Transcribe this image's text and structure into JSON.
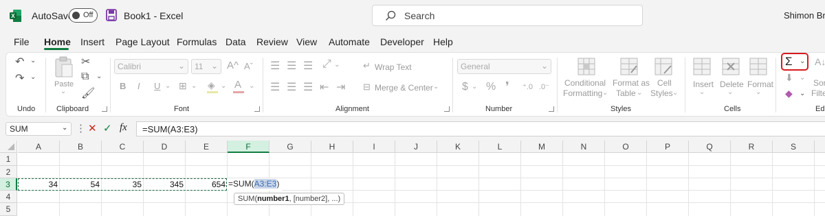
{
  "titlebar": {
    "autosave_label": "AutoSave",
    "autosave_state": "Off",
    "document_title": "Book1  -  Excel",
    "search_placeholder": "Search",
    "user_name": "Shimon Bra"
  },
  "menu": {
    "tabs": [
      "File",
      "Home",
      "Insert",
      "Page Layout",
      "Formulas",
      "Data",
      "Review",
      "View",
      "Automate",
      "Developer",
      "Help"
    ],
    "active": "Home"
  },
  "ribbon": {
    "groups": {
      "undo": "Undo",
      "clipboard": "Clipboard",
      "font": "Font",
      "alignment": "Alignment",
      "number": "Number",
      "styles": "Styles",
      "cells": "Cells",
      "editing": "Edi"
    },
    "clipboard": {
      "paste": "Paste"
    },
    "font": {
      "name": "Calibri",
      "size": "11",
      "bold": "B",
      "italic": "I",
      "underline": "U"
    },
    "alignment": {
      "wrap_text": "Wrap Text",
      "merge_center": "Merge & Center"
    },
    "number": {
      "format": "General",
      "currency": "$",
      "percent": "%"
    },
    "styles": {
      "conditional_formatting": [
        "Conditional",
        "Formatting"
      ],
      "format_as_table": [
        "Format as",
        "Table"
      ],
      "cell_styles": [
        "Cell",
        "Styles"
      ]
    },
    "cells": {
      "insert": "Insert",
      "delete": "Delete",
      "format": "Format"
    },
    "editing": {
      "sort": "Sor",
      "filter": "Filte"
    }
  },
  "formula_bar": {
    "name_box": "SUM",
    "fx": "fx",
    "formula": "=SUM(A3:E3)"
  },
  "sheet": {
    "columns": [
      "A",
      "B",
      "C",
      "D",
      "E",
      "F",
      "G",
      "H",
      "I",
      "J",
      "K",
      "L",
      "M",
      "N",
      "O",
      "P",
      "Q",
      "R",
      "S"
    ],
    "rows": [
      "1",
      "2",
      "3",
      "4",
      "5"
    ],
    "selected_column": "F",
    "selected_row": "3",
    "row3_values": [
      "34",
      "54",
      "35",
      "345",
      "654"
    ],
    "edit_prefix": "=SUM(",
    "edit_ref": "A3:E3",
    "edit_suffix": ")",
    "tooltip": {
      "fn": "SUM(",
      "arg1": "number1",
      "rest": ", [number2], ...)"
    }
  },
  "colors": {
    "excel_green": "#107c41",
    "highlight_red": "#d8191d",
    "ref_blue": "#3a6db5"
  }
}
